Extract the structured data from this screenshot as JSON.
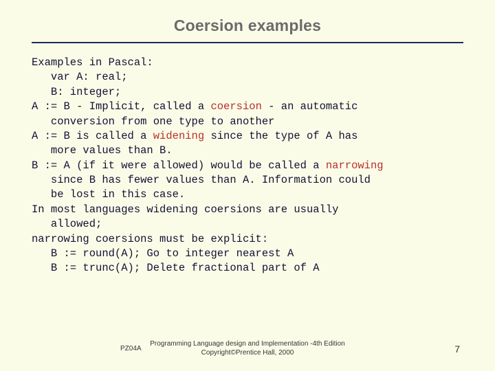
{
  "title": "Coersion examples",
  "lines": [
    [
      {
        "t": "Examples in Pascal:"
      }
    ],
    [
      {
        "t": "   var A: real;"
      }
    ],
    [
      {
        "t": "   B: integer;"
      }
    ],
    [
      {
        "t": "A := B - Implicit, called a "
      },
      {
        "t": "coersion",
        "hl": true
      },
      {
        "t": " - an automatic"
      }
    ],
    [
      {
        "t": "   conversion from one type to another"
      }
    ],
    [
      {
        "t": "A := B is called a "
      },
      {
        "t": "widening",
        "hl": true
      },
      {
        "t": " since the type of A has"
      }
    ],
    [
      {
        "t": "   more values than B."
      }
    ],
    [
      {
        "t": "B := A (if it were allowed) would be called a "
      },
      {
        "t": "narrowing",
        "hl": true
      }
    ],
    [
      {
        "t": "   since B has fewer values than A. Information could"
      }
    ],
    [
      {
        "t": "   be lost in this case."
      }
    ],
    [
      {
        "t": "In most languages widening coersions are usually"
      }
    ],
    [
      {
        "t": "   allowed;"
      }
    ],
    [
      {
        "t": "narrowing coersions must be explicit:"
      }
    ],
    [
      {
        "t": "   B := round(A); Go to integer nearest A"
      }
    ],
    [
      {
        "t": "   B := trunc(A); Delete fractional part of A"
      }
    ]
  ],
  "footer": {
    "left": "PZ04A",
    "center_line1": "Programming Language design and Implementation -4th Edition",
    "center_line2": "Copyright©Prentice Hall, 2000",
    "page": "7"
  }
}
